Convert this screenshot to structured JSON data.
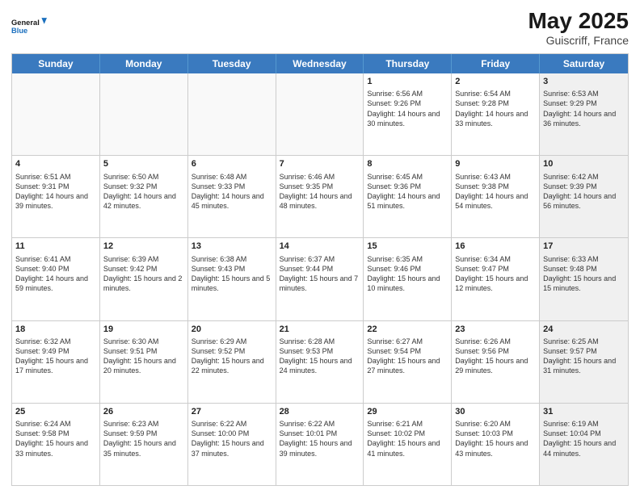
{
  "logo": {
    "line1": "General",
    "line2": "Blue"
  },
  "title": {
    "month_year": "May 2025",
    "location": "Guiscriff, France"
  },
  "weekdays": [
    "Sunday",
    "Monday",
    "Tuesday",
    "Wednesday",
    "Thursday",
    "Friday",
    "Saturday"
  ],
  "rows": [
    [
      {
        "day": "",
        "info": "",
        "empty": true
      },
      {
        "day": "",
        "info": "",
        "empty": true
      },
      {
        "day": "",
        "info": "",
        "empty": true
      },
      {
        "day": "",
        "info": "",
        "empty": true
      },
      {
        "day": "1",
        "info": "Sunrise: 6:56 AM\nSunset: 9:26 PM\nDaylight: 14 hours and 30 minutes."
      },
      {
        "day": "2",
        "info": "Sunrise: 6:54 AM\nSunset: 9:28 PM\nDaylight: 14 hours and 33 minutes."
      },
      {
        "day": "3",
        "info": "Sunrise: 6:53 AM\nSunset: 9:29 PM\nDaylight: 14 hours and 36 minutes.",
        "shaded": true
      }
    ],
    [
      {
        "day": "4",
        "info": "Sunrise: 6:51 AM\nSunset: 9:31 PM\nDaylight: 14 hours and 39 minutes."
      },
      {
        "day": "5",
        "info": "Sunrise: 6:50 AM\nSunset: 9:32 PM\nDaylight: 14 hours and 42 minutes."
      },
      {
        "day": "6",
        "info": "Sunrise: 6:48 AM\nSunset: 9:33 PM\nDaylight: 14 hours and 45 minutes."
      },
      {
        "day": "7",
        "info": "Sunrise: 6:46 AM\nSunset: 9:35 PM\nDaylight: 14 hours and 48 minutes."
      },
      {
        "day": "8",
        "info": "Sunrise: 6:45 AM\nSunset: 9:36 PM\nDaylight: 14 hours and 51 minutes."
      },
      {
        "day": "9",
        "info": "Sunrise: 6:43 AM\nSunset: 9:38 PM\nDaylight: 14 hours and 54 minutes."
      },
      {
        "day": "10",
        "info": "Sunrise: 6:42 AM\nSunset: 9:39 PM\nDaylight: 14 hours and 56 minutes.",
        "shaded": true
      }
    ],
    [
      {
        "day": "11",
        "info": "Sunrise: 6:41 AM\nSunset: 9:40 PM\nDaylight: 14 hours and 59 minutes."
      },
      {
        "day": "12",
        "info": "Sunrise: 6:39 AM\nSunset: 9:42 PM\nDaylight: 15 hours and 2 minutes."
      },
      {
        "day": "13",
        "info": "Sunrise: 6:38 AM\nSunset: 9:43 PM\nDaylight: 15 hours and 5 minutes."
      },
      {
        "day": "14",
        "info": "Sunrise: 6:37 AM\nSunset: 9:44 PM\nDaylight: 15 hours and 7 minutes."
      },
      {
        "day": "15",
        "info": "Sunrise: 6:35 AM\nSunset: 9:46 PM\nDaylight: 15 hours and 10 minutes."
      },
      {
        "day": "16",
        "info": "Sunrise: 6:34 AM\nSunset: 9:47 PM\nDaylight: 15 hours and 12 minutes."
      },
      {
        "day": "17",
        "info": "Sunrise: 6:33 AM\nSunset: 9:48 PM\nDaylight: 15 hours and 15 minutes.",
        "shaded": true
      }
    ],
    [
      {
        "day": "18",
        "info": "Sunrise: 6:32 AM\nSunset: 9:49 PM\nDaylight: 15 hours and 17 minutes."
      },
      {
        "day": "19",
        "info": "Sunrise: 6:30 AM\nSunset: 9:51 PM\nDaylight: 15 hours and 20 minutes."
      },
      {
        "day": "20",
        "info": "Sunrise: 6:29 AM\nSunset: 9:52 PM\nDaylight: 15 hours and 22 minutes."
      },
      {
        "day": "21",
        "info": "Sunrise: 6:28 AM\nSunset: 9:53 PM\nDaylight: 15 hours and 24 minutes."
      },
      {
        "day": "22",
        "info": "Sunrise: 6:27 AM\nSunset: 9:54 PM\nDaylight: 15 hours and 27 minutes."
      },
      {
        "day": "23",
        "info": "Sunrise: 6:26 AM\nSunset: 9:56 PM\nDaylight: 15 hours and 29 minutes."
      },
      {
        "day": "24",
        "info": "Sunrise: 6:25 AM\nSunset: 9:57 PM\nDaylight: 15 hours and 31 minutes.",
        "shaded": true
      }
    ],
    [
      {
        "day": "25",
        "info": "Sunrise: 6:24 AM\nSunset: 9:58 PM\nDaylight: 15 hours and 33 minutes."
      },
      {
        "day": "26",
        "info": "Sunrise: 6:23 AM\nSunset: 9:59 PM\nDaylight: 15 hours and 35 minutes."
      },
      {
        "day": "27",
        "info": "Sunrise: 6:22 AM\nSunset: 10:00 PM\nDaylight: 15 hours and 37 minutes."
      },
      {
        "day": "28",
        "info": "Sunrise: 6:22 AM\nSunset: 10:01 PM\nDaylight: 15 hours and 39 minutes."
      },
      {
        "day": "29",
        "info": "Sunrise: 6:21 AM\nSunset: 10:02 PM\nDaylight: 15 hours and 41 minutes."
      },
      {
        "day": "30",
        "info": "Sunrise: 6:20 AM\nSunset: 10:03 PM\nDaylight: 15 hours and 43 minutes."
      },
      {
        "day": "31",
        "info": "Sunrise: 6:19 AM\nSunset: 10:04 PM\nDaylight: 15 hours and 44 minutes.",
        "shaded": true
      }
    ]
  ]
}
